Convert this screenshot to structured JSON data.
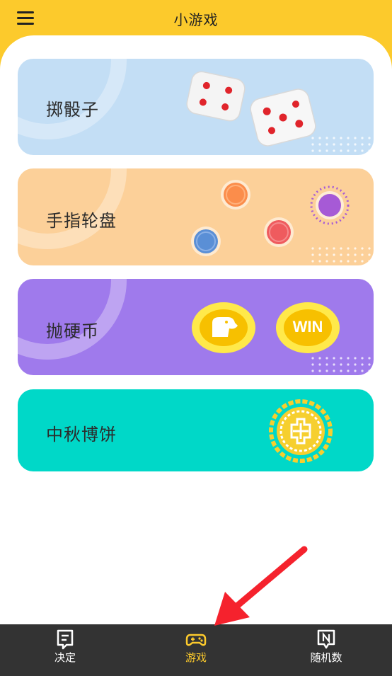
{
  "header": {
    "title": "小游戏",
    "menu_icon": "hamburger-menu-icon"
  },
  "cards": [
    {
      "label": "掷骰子",
      "color": "#c3def5",
      "icon": "dice-icon"
    },
    {
      "label": "手指轮盘",
      "color": "#fcd099",
      "icon": "finger-roulette-icon"
    },
    {
      "label": "抛硬币",
      "color": "#9f7aec",
      "icon": "coin-icon",
      "coin_text": "WIN"
    },
    {
      "label": "中秋博饼",
      "color": "#00d8c8",
      "icon": "mooncake-icon"
    }
  ],
  "tabbar": {
    "tabs": [
      {
        "label": "决定",
        "icon": "decision-icon",
        "active": false
      },
      {
        "label": "游戏",
        "icon": "gamepad-icon",
        "active": true
      },
      {
        "label": "随机数",
        "icon": "random-number-icon",
        "active": false
      }
    ],
    "active_color": "#fcca2c",
    "inactive_color": "#ffffff"
  }
}
